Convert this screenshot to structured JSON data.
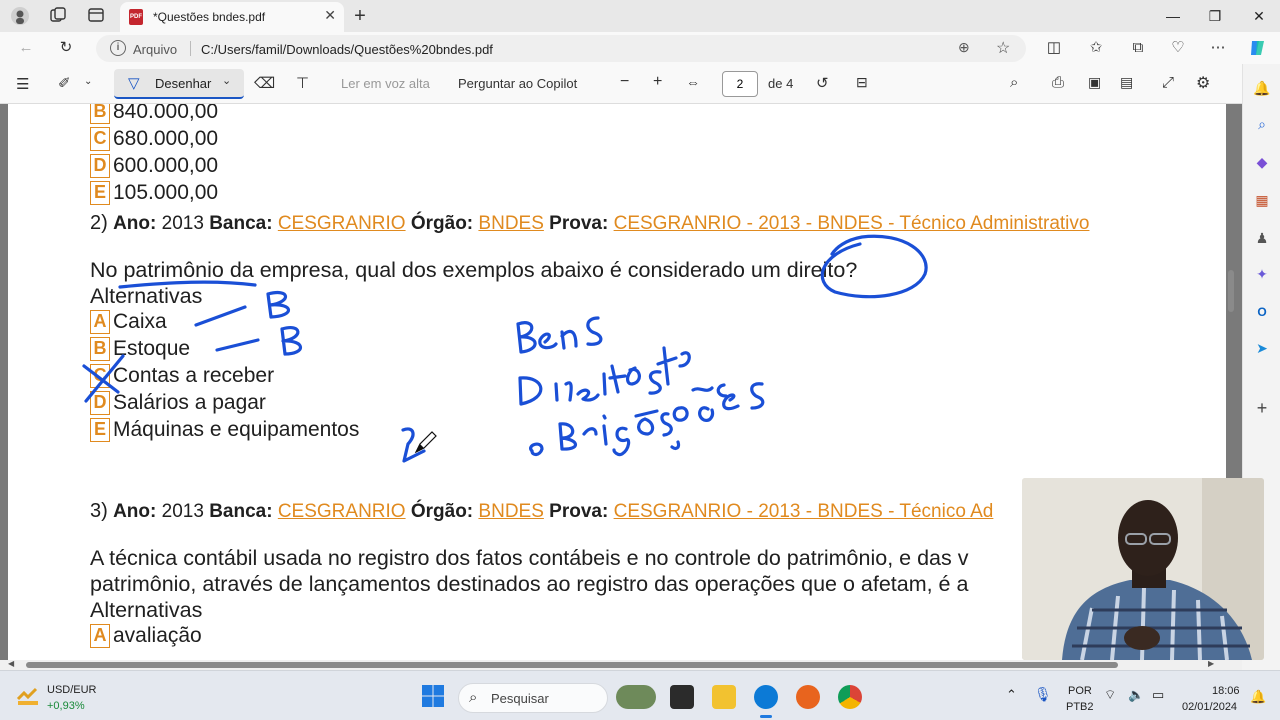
{
  "tab": {
    "title": "*Questões bndes.pdf"
  },
  "address": {
    "origin_label": "Arquivo",
    "url": "C:/Users/famil/Downloads/Questões%20bndes.pdf"
  },
  "pdf_toolbar": {
    "draw_label": "Desenhar",
    "read_aloud_label": "Ler em voz alta",
    "copilot_label": "Perguntar ao Copilot",
    "page_current": "2",
    "page_total": "de 4"
  },
  "document": {
    "prev_options": [
      {
        "letter": "B",
        "text": "840.000,00"
      },
      {
        "letter": "C",
        "text": "680.000,00"
      },
      {
        "letter": "D",
        "text": "600.000,00"
      },
      {
        "letter": "E",
        "text": "105.000,00"
      }
    ],
    "q2": {
      "number": "2)",
      "ano_label": "Ano:",
      "ano": "2013",
      "banca_label": "Banca:",
      "banca": "CESGRANRIO",
      "orgao_label": "Órgão:",
      "orgao": "BNDES",
      "prova_label": "Prova:",
      "prova": "CESGRANRIO - 2013 - BNDES - Técnico Administrativo",
      "question": "No patrimônio da empresa, qual dos exemplos abaixo é considerado um direito?",
      "alternatives_label": "Alternativas",
      "options": [
        {
          "letter": "A",
          "text": "Caixa"
        },
        {
          "letter": "B",
          "text": "Estoque"
        },
        {
          "letter": "C",
          "text": "Contas a receber"
        },
        {
          "letter": "D",
          "text": "Salários a pagar"
        },
        {
          "letter": "E",
          "text": "Máquinas e equipamentos"
        }
      ]
    },
    "q3": {
      "number": "3)",
      "ano_label": "Ano:",
      "ano": "2013",
      "banca_label": "Banca:",
      "banca": "CESGRANRIO",
      "orgao_label": "Órgão:",
      "orgao": "BNDES",
      "prova_label": "Prova:",
      "prova": "CESGRANRIO - 2013 - BNDES - Técnico Ad",
      "line1": "A técnica contábil usada no registro dos fatos contábeis e no controle do patrimônio, e das v",
      "line2": "patrimônio, através de lançamentos destinados ao registro das operações que o afetam, é a",
      "alternatives_label": "Alternativas",
      "options": [
        {
          "letter": "A",
          "text": "avaliação"
        }
      ]
    }
  },
  "ink": {
    "color": "#1a4fd6"
  },
  "taskbar": {
    "widget_title": "USD/EUR",
    "widget_value": "+0,93%",
    "search_placeholder": "Pesquisar",
    "lang_top": "POR",
    "lang_bottom": "PTB2",
    "time": "18:06",
    "date": "02/01/2024"
  }
}
